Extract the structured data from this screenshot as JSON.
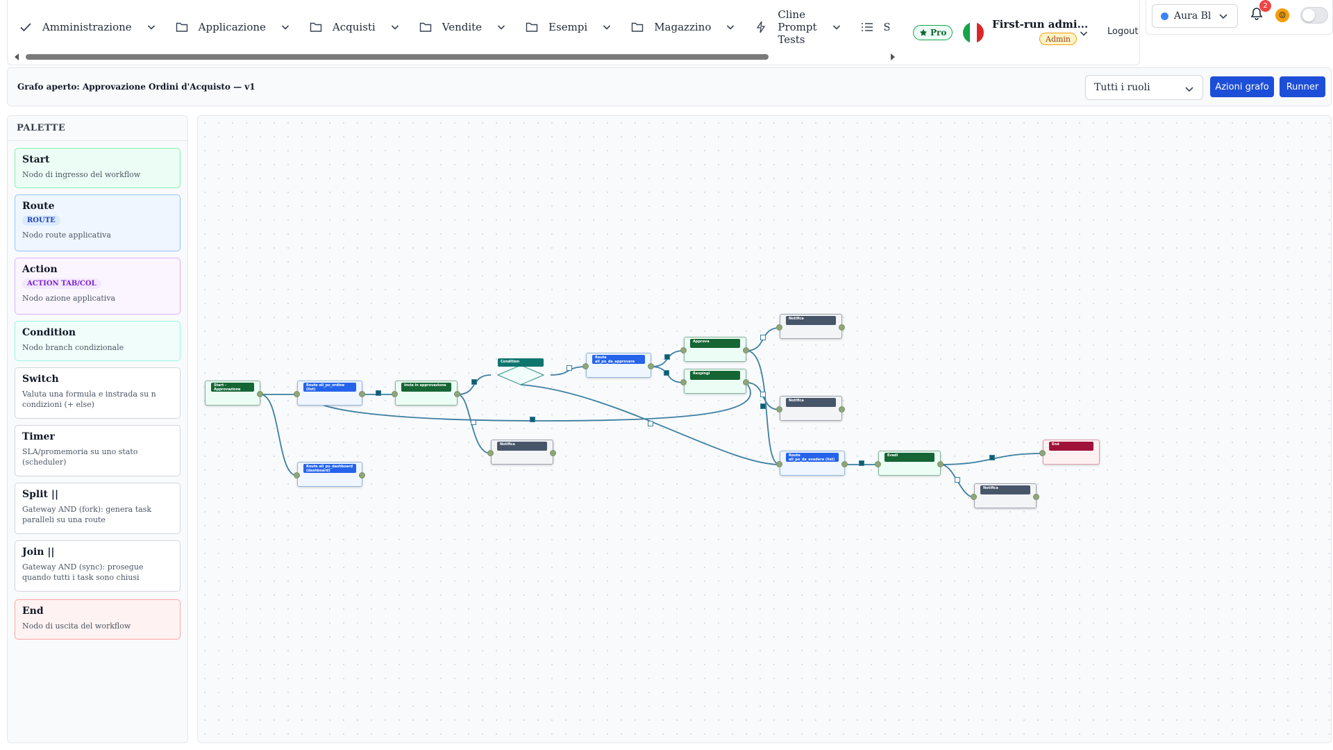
{
  "nav": {
    "items": [
      {
        "icon": "check-icon",
        "label": "Amministrazione"
      },
      {
        "icon": "folder-icon",
        "label": "Applicazione"
      },
      {
        "icon": "folder-icon",
        "label": "Acquisti"
      },
      {
        "icon": "folder-icon",
        "label": "Vendite"
      },
      {
        "icon": "folder-icon",
        "label": "Esempi"
      },
      {
        "icon": "folder-icon",
        "label": "Magazzino"
      },
      {
        "icon": "bolt-icon",
        "label_lines": [
          "Cline",
          "Prompt",
          "Tests"
        ]
      },
      {
        "icon": "list-icon",
        "label": "Scadenz"
      }
    ],
    "pro_label": "Pro",
    "user_name": "First-run admi...",
    "role_badge": "Admin",
    "logout_label": "Logout"
  },
  "topright": {
    "theme_label": "Aura Blu",
    "notification_count": "2"
  },
  "graph_header": {
    "title": "Grafo aperto: Approvazione Ordini d'Acquisto — v1",
    "role_filter": "Tutti i ruoli",
    "actions_label": "Azioni grafo",
    "runner_label": "Runner"
  },
  "palette": {
    "title": "PALETTE",
    "items": [
      {
        "title": "Start",
        "desc": "Nodo di ingresso del workflow",
        "chip": ""
      },
      {
        "title": "Route",
        "desc": "Nodo route applicativa",
        "chip": "ROUTE"
      },
      {
        "title": "Action",
        "desc": "Nodo azione applicativa",
        "chip": "ACTION TAB/COL"
      },
      {
        "title": "Condition",
        "desc": "Nodo branch condizionale",
        "chip": ""
      },
      {
        "title": "Switch",
        "desc": "Valuta una formula e instrada su n condizioni (+ else)",
        "chip": ""
      },
      {
        "title": "Timer",
        "desc": "SLA/promemoria su uno stato (scheduler)",
        "chip": ""
      },
      {
        "title": "Split ||",
        "desc": "Gateway AND (fork): genera task paralleli su una route",
        "chip": ""
      },
      {
        "title": "Join ||",
        "desc": "Gateway AND (sync): prosegue quando tutti i task sono chiusi",
        "chip": ""
      },
      {
        "title": "End",
        "desc": "Nodo di uscita del workflow",
        "chip": ""
      }
    ]
  },
  "graph": {
    "nodes": [
      {
        "id": "start",
        "label": "Start - Approvazione Ordini",
        "kind": "start"
      },
      {
        "id": "route_list",
        "label": "Route all_po_ordine (list)",
        "kind": "route"
      },
      {
        "id": "route_dash",
        "label": "Route all_po_dashboard (dashboard)",
        "kind": "route"
      },
      {
        "id": "invia",
        "label": "Invia in approvazione",
        "kind": "action"
      },
      {
        "id": "cond",
        "label": "Condition",
        "kind": "condition"
      },
      {
        "id": "notif1",
        "label": "Notifica",
        "kind": "notify"
      },
      {
        "id": "route_approve",
        "label": "Route all_po_da_approvare (list)",
        "kind": "route"
      },
      {
        "id": "approva",
        "label": "Approva",
        "kind": "action"
      },
      {
        "id": "respingi",
        "label": "Respingi",
        "kind": "action"
      },
      {
        "id": "notif2",
        "label": "Notifica",
        "kind": "notify"
      },
      {
        "id": "notif3",
        "label": "Notifica",
        "kind": "notify"
      },
      {
        "id": "route_evadere",
        "label": "Route all_po_da_evadere (list)",
        "kind": "route"
      },
      {
        "id": "evadi",
        "label": "Evadi",
        "kind": "action"
      },
      {
        "id": "notif4",
        "label": "Notifica",
        "kind": "notify"
      },
      {
        "id": "end",
        "label": "End",
        "kind": "end"
      }
    ],
    "colors": {
      "start_header": "#166534",
      "route_header": "#2563eb",
      "action_header": "#166534",
      "condition_header": "#0f766e",
      "notify_header": "#475569",
      "end_header": "#9f1239",
      "edge": "#3b7ea1"
    }
  }
}
